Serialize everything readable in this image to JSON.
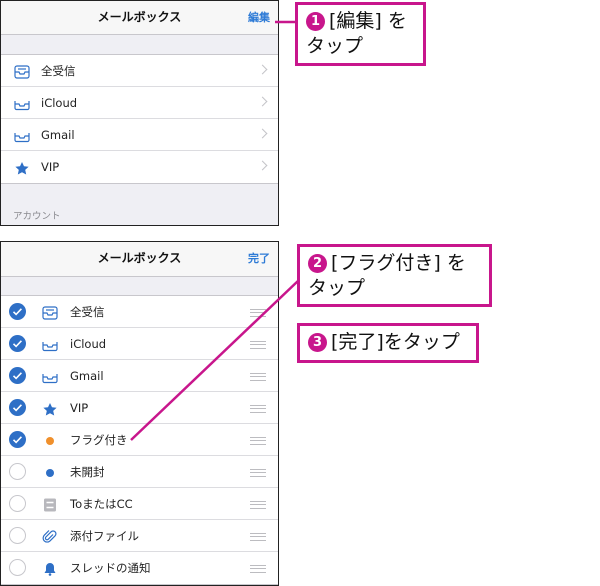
{
  "colors": {
    "accent": "#2e7bd6",
    "callout": "#c8168c",
    "check": "#2e6fc6",
    "flag": "#f0902c",
    "unread": "#2e6fc6"
  },
  "panel1": {
    "title": "メールボックス",
    "edit_label": "編集",
    "rows": [
      {
        "label": "全受信",
        "icon": "tray-stack-icon"
      },
      {
        "label": "iCloud",
        "icon": "tray-icon"
      },
      {
        "label": "Gmail",
        "icon": "tray-icon"
      },
      {
        "label": "VIP",
        "icon": "star-icon"
      }
    ],
    "section_header": "アカウント"
  },
  "panel2": {
    "title": "メールボックス",
    "done_label": "完了",
    "rows": [
      {
        "label": "全受信",
        "icon": "tray-stack-icon",
        "checked": true
      },
      {
        "label": "iCloud",
        "icon": "tray-icon",
        "checked": true
      },
      {
        "label": "Gmail",
        "icon": "tray-icon",
        "checked": true
      },
      {
        "label": "VIP",
        "icon": "star-icon",
        "checked": true
      },
      {
        "label": "フラグ付き",
        "icon": "flag-dot-icon",
        "checked": true
      },
      {
        "label": "未開封",
        "icon": "unread-dot-icon",
        "checked": false
      },
      {
        "label": "ToまたはCC",
        "icon": "to-cc-icon",
        "checked": false
      },
      {
        "label": "添付ファイル",
        "icon": "paperclip-icon",
        "checked": false
      },
      {
        "label": "スレッドの通知",
        "icon": "bell-icon",
        "checked": false
      }
    ]
  },
  "callouts": [
    {
      "number": "❶",
      "text_line1": "[編集] を",
      "text_line2": "タップ"
    },
    {
      "number": "❷",
      "text_line1": "[フラグ付き] を",
      "text_line2": "タップ"
    },
    {
      "number": "❸",
      "text_line1": "[完了]をタップ"
    }
  ]
}
